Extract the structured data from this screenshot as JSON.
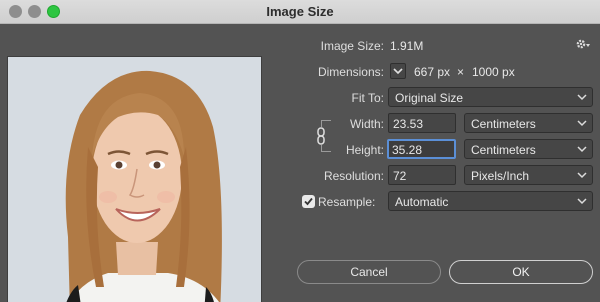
{
  "window": {
    "title": "Image Size"
  },
  "image_size": {
    "label": "Image Size:",
    "value": "1.91M"
  },
  "dimensions": {
    "label": "Dimensions:",
    "width": "667 px",
    "times": "×",
    "height": "1000 px"
  },
  "fit_to": {
    "label": "Fit To:",
    "value": "Original Size"
  },
  "width": {
    "label": "Width:",
    "value": "23.53",
    "unit": "Centimeters"
  },
  "height": {
    "label": "Height:",
    "value": "35.28",
    "unit": "Centimeters"
  },
  "resolution": {
    "label": "Resolution:",
    "value": "72",
    "unit": "Pixels/Inch"
  },
  "resample": {
    "label": "Resample:",
    "checked": true,
    "value": "Automatic"
  },
  "buttons": {
    "cancel": "Cancel",
    "ok": "OK"
  },
  "icons": {
    "settings": "gear-icon",
    "link": "chain-link-icon",
    "dropdown": "chevron-down-icon",
    "dimensions_toggle": "chevron-down-icon",
    "checkbox": "checkmark-icon"
  },
  "colors": {
    "dialog_bg": "#535353",
    "field_bg": "#464646",
    "focus_ring": "#5b8fd6",
    "maximize": "#2dc541"
  }
}
